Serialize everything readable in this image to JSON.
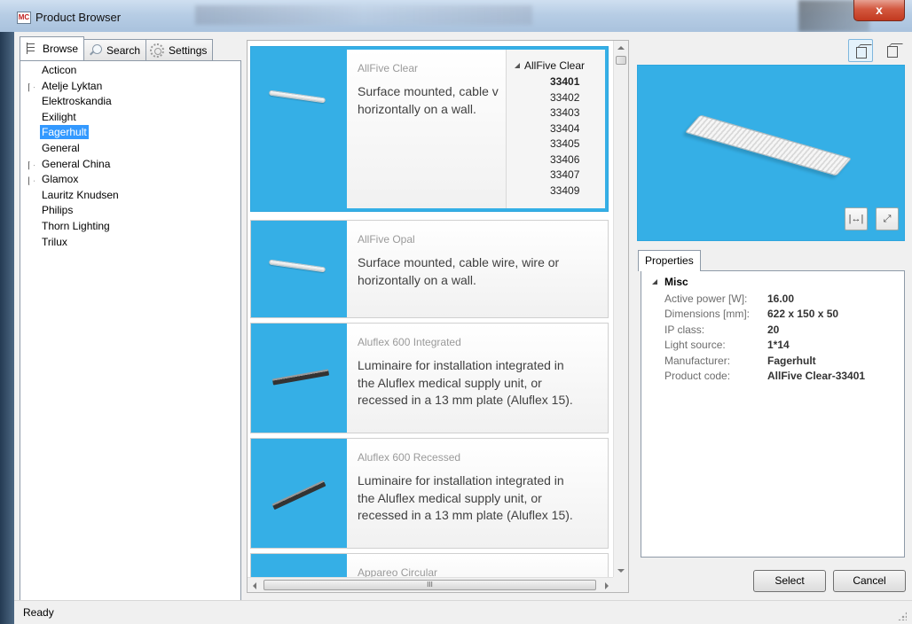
{
  "window": {
    "title": "Product Browser",
    "close_label": "x",
    "logo_text": "MC"
  },
  "tabs": [
    {
      "label": "Browse",
      "icon": "browse-tree-icon"
    },
    {
      "label": "Search",
      "icon": "search-icon"
    },
    {
      "label": "Settings",
      "icon": "gear-icon"
    }
  ],
  "tree": {
    "items": [
      {
        "label": "Acticon",
        "expandable": false
      },
      {
        "label": "Atelje Lyktan",
        "expandable": true
      },
      {
        "label": "Elektroskandia",
        "expandable": false
      },
      {
        "label": "Exilight",
        "expandable": false
      },
      {
        "label": "Fagerhult",
        "expandable": false,
        "selected": true
      },
      {
        "label": "General",
        "expandable": false
      },
      {
        "label": "General China",
        "expandable": true
      },
      {
        "label": "Glamox",
        "expandable": true
      },
      {
        "label": "Lauritz Knudsen",
        "expandable": false
      },
      {
        "label": "Philips",
        "expandable": false
      },
      {
        "label": "Thorn Lighting",
        "expandable": false
      },
      {
        "label": "Trilux",
        "expandable": false
      }
    ]
  },
  "products": [
    {
      "name": "AllFive Clear",
      "desc_lines": [
        "Surface mounted, cable v",
        "horizontally on a wall."
      ],
      "selected": true
    },
    {
      "name": "AllFive Opal",
      "desc_lines": [
        "Surface mounted, cable wire, wire or",
        "horizontally on a wall."
      ]
    },
    {
      "name": "Aluflex 600 Integrated",
      "desc_lines": [
        "Luminaire for installation integrated in",
        "the Aluflex medical supply unit, or",
        "recessed in a 13 mm plate (Aluflex 15)."
      ]
    },
    {
      "name": "Aluflex 600 Recessed",
      "desc_lines": [
        "Luminaire for installation integrated in",
        "the Aluflex medical supply unit, or",
        "recessed in a 13 mm plate (Aluflex 15)."
      ]
    },
    {
      "name": "Appareo Circular",
      "desc_lines": []
    }
  ],
  "variants": {
    "header": "AllFive Clear",
    "items": [
      "33401",
      "33402",
      "33403",
      "33404",
      "33405",
      "33406",
      "33407",
      "33409"
    ],
    "selected_index": 0
  },
  "scroll": {
    "h_thumb_label": "III"
  },
  "properties": {
    "tab_label": "Properties",
    "category": "Misc",
    "rows": [
      {
        "key": "Active power [W]:",
        "value": "16.00"
      },
      {
        "key": "Dimensions [mm]:",
        "value": "622 x 150 x 50"
      },
      {
        "key": "IP class:",
        "value": "20"
      },
      {
        "key": "Light source:",
        "value": "1*14"
      },
      {
        "key": "Manufacturer:",
        "value": "Fagerhult"
      },
      {
        "key": "Product code:",
        "value": "AllFive Clear-33401"
      }
    ]
  },
  "buttons": {
    "select": "Select",
    "cancel": "Cancel",
    "fit_glyph": "|↔|",
    "full_glyph": "⤢"
  },
  "status": {
    "text": "Ready"
  },
  "colors": {
    "accent": "#35afe6",
    "selection": "#3399ff"
  }
}
